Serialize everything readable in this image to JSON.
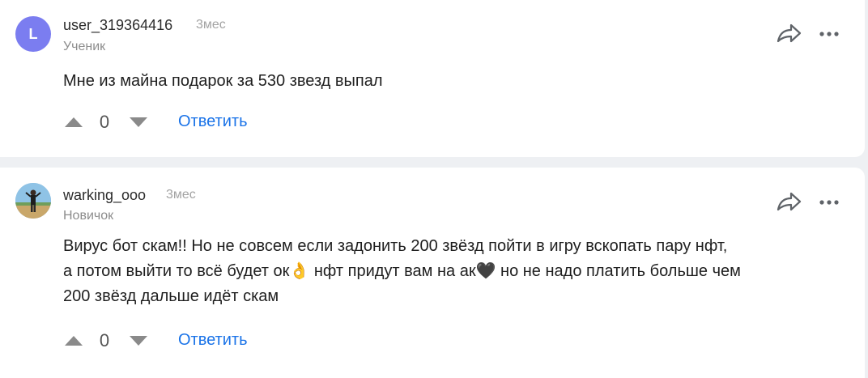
{
  "comments": [
    {
      "avatar_letter": "L",
      "username": "user_319364416",
      "time": "3мес",
      "role": "Ученик",
      "text": "Мне из майна подарок за 530 звезд выпал",
      "votes": "0",
      "reply_label": "Ответить"
    },
    {
      "username": "warking_ooo",
      "time": "3мес",
      "role": "Новичок",
      "text_line1": "Вирус бот скам!! Но не совсем если задонить 200 звёзд пойти в игру вскопать пару нфт,",
      "text_line2a": "а потом выйти то всё будет ок",
      "text_emoji1": "👌",
      "text_line2b": " нфт придут вам на ак",
      "text_emoji2": "🖤",
      "text_line2c": " но не надо платить больше чем",
      "text_line3": "200 звёзд дальше идёт скам",
      "votes": "0",
      "reply_label": "Ответить"
    }
  ],
  "colors": {
    "avatar_bg": "#7b7df0",
    "link": "#1a73e8",
    "page_bg": "#eef0f3"
  },
  "icons": [
    "share-icon",
    "more-icon",
    "arrow-up-icon",
    "arrow-down-icon"
  ]
}
